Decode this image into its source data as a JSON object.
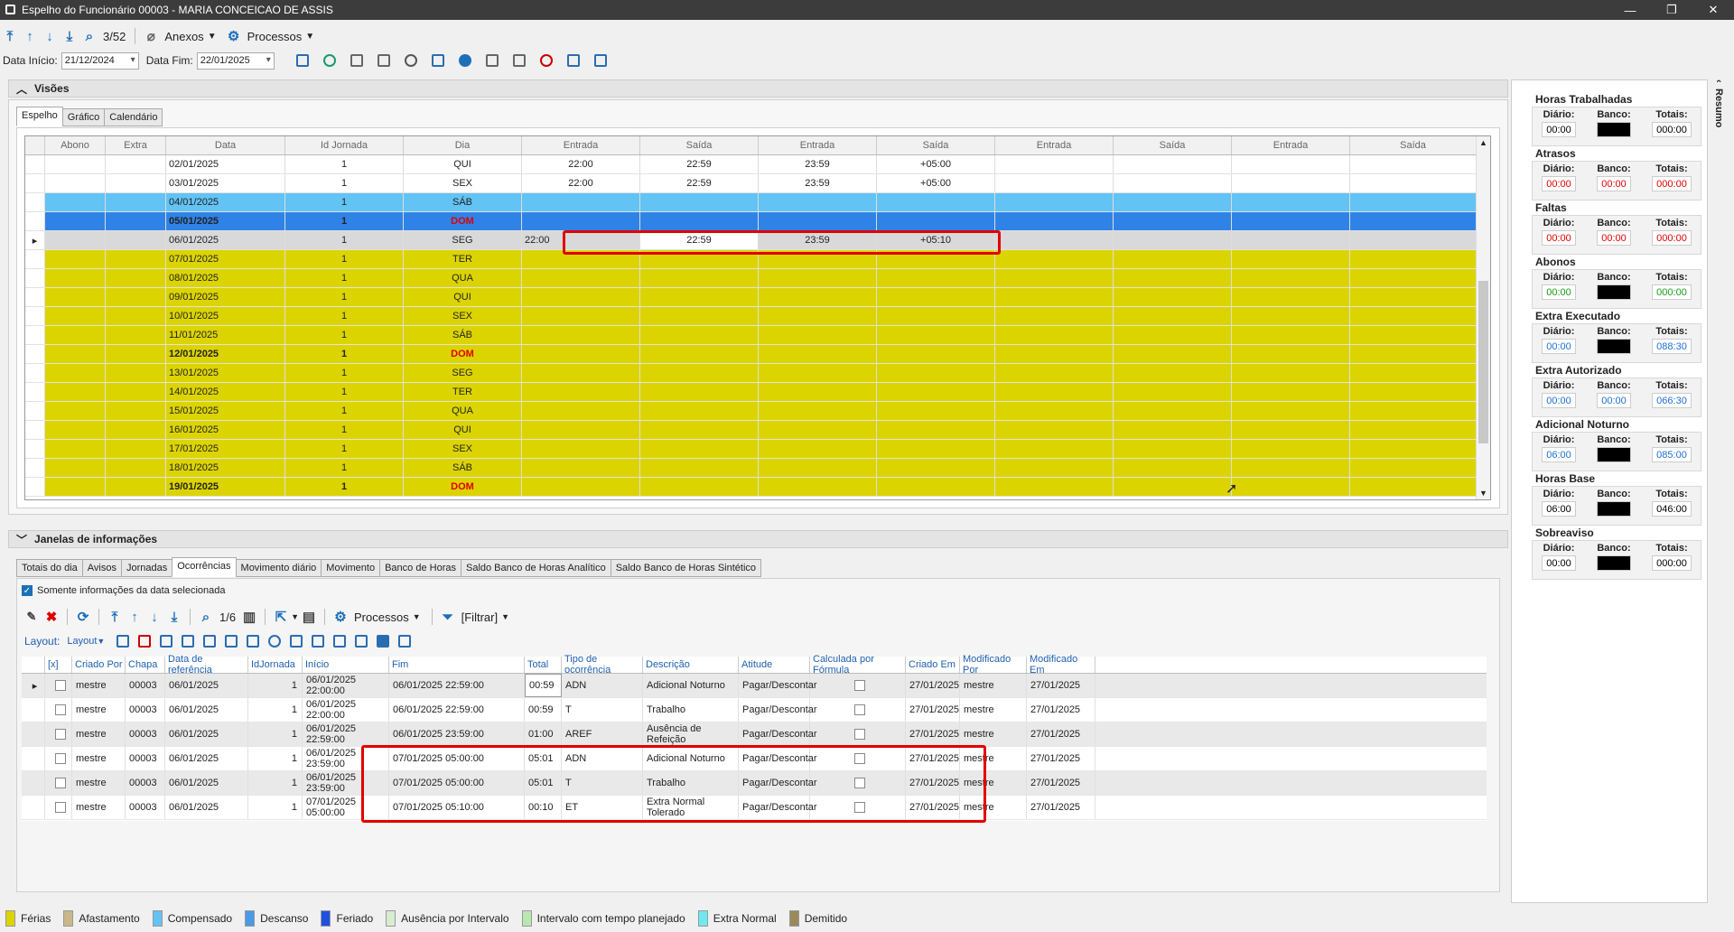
{
  "window": {
    "title": "Espelho do Funcionário 00003 - MARIA CONCEICAO DE ASSIS"
  },
  "toolbar": {
    "counter": "3/52",
    "anexos": "Anexos",
    "processos": "Processos"
  },
  "filters": {
    "data_inicio_label": "Data Início:",
    "data_inicio": "21/12/2024",
    "data_fim_label": "Data Fim:",
    "data_fim": "22/01/2025"
  },
  "visoes": {
    "title": "Visões",
    "tabs": [
      "Espelho",
      "Gráfico",
      "Calendário"
    ],
    "columns": [
      "Abono",
      "Extra",
      "Data",
      "Id Jornada",
      "Dia",
      "Entrada",
      "Saída",
      "Entrada",
      "Saída",
      "Entrada",
      "Saída",
      "Entrada",
      "Saída"
    ],
    "rows": [
      {
        "style": "white",
        "data": "02/01/2025",
        "id": "1",
        "dia": "QUI",
        "e1": "22:00",
        "s1": "22:59",
        "e2": "23:59",
        "s2": "+05:00"
      },
      {
        "style": "white",
        "data": "03/01/2025",
        "id": "1",
        "dia": "SEX",
        "e1": "22:00",
        "s1": "22:59",
        "e2": "23:59",
        "s2": "+05:00"
      },
      {
        "style": "lightblue",
        "data": "04/01/2025",
        "id": "1",
        "dia": "SÁB",
        "e1": "",
        "s1": "",
        "e2": "",
        "s2": ""
      },
      {
        "style": "blue",
        "data": "05/01/2025",
        "id": "1",
        "dia": "DOM",
        "e1": "",
        "s1": "",
        "e2": "",
        "s2": ""
      },
      {
        "style": "sel",
        "data": "06/01/2025",
        "id": "1",
        "dia": "SEG",
        "e1": "22:00",
        "s1": "22:59",
        "e2": "23:59",
        "s2": "+05:10"
      },
      {
        "style": "yellow",
        "data": "07/01/2025",
        "id": "1",
        "dia": "TER",
        "e1": "",
        "s1": "",
        "e2": "",
        "s2": ""
      },
      {
        "style": "yellow",
        "data": "08/01/2025",
        "id": "1",
        "dia": "QUA",
        "e1": "",
        "s1": "",
        "e2": "",
        "s2": ""
      },
      {
        "style": "yellow",
        "data": "09/01/2025",
        "id": "1",
        "dia": "QUI",
        "e1": "",
        "s1": "",
        "e2": "",
        "s2": ""
      },
      {
        "style": "yellow",
        "data": "10/01/2025",
        "id": "1",
        "dia": "SEX",
        "e1": "",
        "s1": "",
        "e2": "",
        "s2": ""
      },
      {
        "style": "yellow",
        "data": "11/01/2025",
        "id": "1",
        "dia": "SÁB",
        "e1": "",
        "s1": "",
        "e2": "",
        "s2": ""
      },
      {
        "style": "yellow-dom",
        "data": "12/01/2025",
        "id": "1",
        "dia": "DOM",
        "e1": "",
        "s1": "",
        "e2": "",
        "s2": ""
      },
      {
        "style": "yellow",
        "data": "13/01/2025",
        "id": "1",
        "dia": "SEG",
        "e1": "",
        "s1": "",
        "e2": "",
        "s2": ""
      },
      {
        "style": "yellow",
        "data": "14/01/2025",
        "id": "1",
        "dia": "TER",
        "e1": "",
        "s1": "",
        "e2": "",
        "s2": ""
      },
      {
        "style": "yellow",
        "data": "15/01/2025",
        "id": "1",
        "dia": "QUA",
        "e1": "",
        "s1": "",
        "e2": "",
        "s2": ""
      },
      {
        "style": "yellow",
        "data": "16/01/2025",
        "id": "1",
        "dia": "QUI",
        "e1": "",
        "s1": "",
        "e2": "",
        "s2": ""
      },
      {
        "style": "yellow",
        "data": "17/01/2025",
        "id": "1",
        "dia": "SEX",
        "e1": "",
        "s1": "",
        "e2": "",
        "s2": ""
      },
      {
        "style": "yellow",
        "data": "18/01/2025",
        "id": "1",
        "dia": "SÁB",
        "e1": "",
        "s1": "",
        "e2": "",
        "s2": ""
      },
      {
        "style": "yellow-dom",
        "data": "19/01/2025",
        "id": "1",
        "dia": "DOM",
        "e1": "",
        "s1": "",
        "e2": "",
        "s2": ""
      }
    ]
  },
  "janelas": {
    "title": "Janelas de informações",
    "tabs": [
      "Totais do dia",
      "Avisos",
      "Jornadas",
      "Ocorrências",
      "Movimento diário",
      "Movimento",
      "Banco de Horas",
      "Saldo Banco de Horas Analítico",
      "Saldo Banco de Horas Sintético"
    ],
    "checkbox_label": "Somente informações da data selecionada",
    "toolbar": {
      "counter": "1/6",
      "processos": "Processos",
      "filtrar": "[Filtrar]",
      "layout_label": "Layout:",
      "layout": "Layout"
    },
    "columns": [
      "[x]",
      "Criado Por",
      "Chapa",
      "Data de referência",
      "IdJornada",
      "Início",
      "Fim",
      "Total",
      "Tipo de ocorrência",
      "Descrição",
      "Atitude",
      "Calculada por Fórmula",
      "Criado Em",
      "Modificado Por",
      "Modificado Em"
    ],
    "rows": [
      [
        "mestre",
        "00003",
        "06/01/2025",
        "1",
        "06/01/2025 22:00:00",
        "06/01/2025 22:59:00",
        "00:59",
        "ADN",
        "Adicional Noturno",
        "Pagar/Descontar",
        "27/01/2025",
        "mestre",
        "27/01/2025"
      ],
      [
        "mestre",
        "00003",
        "06/01/2025",
        "1",
        "06/01/2025 22:00:00",
        "06/01/2025 22:59:00",
        "00:59",
        "T",
        "Trabalho",
        "Pagar/Descontar",
        "27/01/2025",
        "mestre",
        "27/01/2025"
      ],
      [
        "mestre",
        "00003",
        "06/01/2025",
        "1",
        "06/01/2025 22:59:00",
        "06/01/2025 23:59:00",
        "01:00",
        "AREF",
        "Ausência de Refeição",
        "Pagar/Descontar",
        "27/01/2025",
        "mestre",
        "27/01/2025"
      ],
      [
        "mestre",
        "00003",
        "06/01/2025",
        "1",
        "06/01/2025 23:59:00",
        "07/01/2025 05:00:00",
        "05:01",
        "ADN",
        "Adicional Noturno",
        "Pagar/Descontar",
        "27/01/2025",
        "mestre",
        "27/01/2025"
      ],
      [
        "mestre",
        "00003",
        "06/01/2025",
        "1",
        "06/01/2025 23:59:00",
        "07/01/2025 05:00:00",
        "05:01",
        "T",
        "Trabalho",
        "Pagar/Descontar",
        "27/01/2025",
        "mestre",
        "27/01/2025"
      ],
      [
        "mestre",
        "00003",
        "06/01/2025",
        "1",
        "07/01/2025 05:00:00",
        "07/01/2025 05:10:00",
        "00:10",
        "ET",
        "Extra Normal Tolerado",
        "Pagar/Descontar",
        "27/01/2025",
        "mestre",
        "27/01/2025"
      ]
    ]
  },
  "resumo": {
    "tab_label": "Resumo",
    "labels": {
      "diario": "Diário:",
      "banco": "Banco:",
      "totais": "Totais:"
    },
    "groups": [
      {
        "title": "Horas Trabalhadas",
        "diario": "00:00",
        "banco": "",
        "totais": "000:00",
        "color": "#000000",
        "banco_black": true
      },
      {
        "title": "Atrasos",
        "diario": "00:00",
        "banco": "00:00",
        "totais": "000:00",
        "color": "#e00000",
        "banco_black": false
      },
      {
        "title": "Faltas",
        "diario": "00:00",
        "banco": "00:00",
        "totais": "000:00",
        "color": "#e00000",
        "banco_black": false
      },
      {
        "title": "Abonos",
        "diario": "00:00",
        "banco": "",
        "totais": "000:00",
        "color": "#1a9a1a",
        "banco_black": true
      },
      {
        "title": "Extra Executado",
        "diario": "00:00",
        "banco": "",
        "totais": "088:30",
        "color": "#1e6fd0",
        "banco_black": true
      },
      {
        "title": "Extra Autorizado",
        "diario": "00:00",
        "banco": "00:00",
        "totais": "066:30",
        "color": "#1e6fd0",
        "banco_black": false
      },
      {
        "title": "Adicional Noturno",
        "diario": "06:00",
        "banco": "",
        "totais": "085:00",
        "color": "#1e6fd0",
        "banco_black": true
      },
      {
        "title": "Horas Base",
        "diario": "06:00",
        "banco": "",
        "totais": "046:00",
        "color": "#000000",
        "banco_black": true
      },
      {
        "title": "Sobreaviso",
        "diario": "00:00",
        "banco": "",
        "totais": "000:00",
        "color": "#000000",
        "banco_black": true
      }
    ]
  },
  "legend": [
    {
      "label": "Férias",
      "color": "#dcd400"
    },
    {
      "label": "Afastamento",
      "color": "#c8b88a"
    },
    {
      "label": "Compensado",
      "color": "#62c3f4"
    },
    {
      "label": "Descanso",
      "color": "#4a9ae8"
    },
    {
      "label": "Feriado",
      "color": "#2050e0"
    },
    {
      "label": "Ausência por Intervalo",
      "color": "#d8ecd0"
    },
    {
      "label": "Intervalo com tempo planejado",
      "color": "#b8e8b0"
    },
    {
      "label": "Extra Normal",
      "color": "#70e8f0"
    },
    {
      "label": "Demitido",
      "color": "#9a8a5a"
    }
  ]
}
